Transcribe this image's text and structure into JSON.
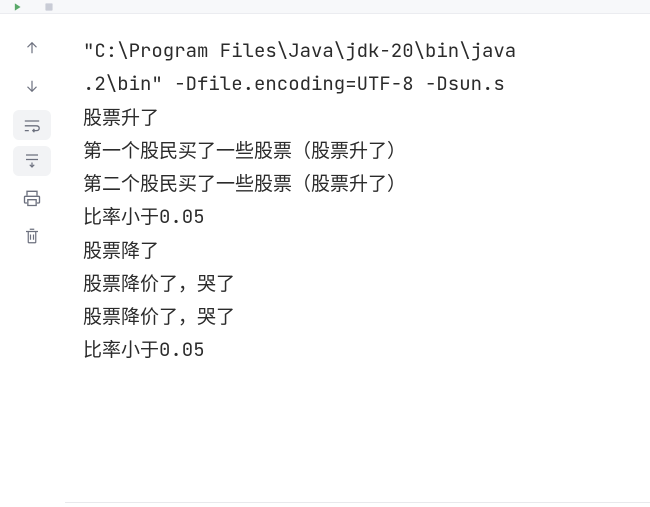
{
  "toolbar": {
    "rerun": "rerun",
    "stop": "stop",
    "more": "more"
  },
  "gutter": {
    "up": "scroll-up",
    "down": "scroll-down",
    "softwrap": "soft-wrap",
    "scroll_to_end": "scroll-to-end",
    "print": "print",
    "delete": "clear"
  },
  "console": {
    "cmd1": "\"C:\\Program Files\\Java\\jdk-20\\bin\\java",
    "cmd2": ".2\\bin\" -Dfile.encoding=UTF-8 -Dsun.s",
    "lines": [
      "股票升了",
      "第一个股民买了一些股票（股票升了）",
      "第二个股民买了一些股票（股票升了）",
      "比率小于0.05",
      "",
      "股票降了",
      "股票降价了，哭了",
      "股票降价了，哭了",
      "比率小于0.05"
    ]
  }
}
